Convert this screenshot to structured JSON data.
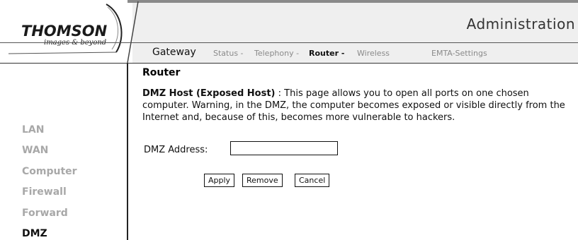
{
  "brand": {
    "name": "THOMSON",
    "tagline": "images & beyond"
  },
  "header": {
    "title": "Administration"
  },
  "nav": {
    "gateway": "Gateway",
    "items": [
      {
        "label": "Status -",
        "active": false
      },
      {
        "label": "Telephony -",
        "active": false
      },
      {
        "label": "Router -",
        "active": true
      },
      {
        "label": "Wireless",
        "active": false
      },
      {
        "label": "EMTA-Settings",
        "active": false
      }
    ]
  },
  "sidebar": {
    "items": [
      {
        "label": "LAN",
        "active": false
      },
      {
        "label": "WAN",
        "active": false
      },
      {
        "label": "Computer",
        "active": false
      },
      {
        "label": "Firewall",
        "active": false
      },
      {
        "label": "Forward",
        "active": false
      },
      {
        "label": "DMZ",
        "active": true
      }
    ]
  },
  "content": {
    "title": "Router",
    "desc_bold": "DMZ Host (Exposed Host)",
    "desc_text": " : This page allows you to open all ports on one chosen computer. Warning, in the DMZ, the computer becomes exposed or visible directly from the Internet and, because of this, becomes more vulnerable to hackers.",
    "dmz_label": "DMZ Address:",
    "dmz_value": "",
    "buttons": {
      "apply": "Apply",
      "remove": "Remove",
      "cancel": "Cancel"
    }
  },
  "colors": {
    "header_bg": "#efefef",
    "inactive_text": "#a8a8a8",
    "rule": "#222222"
  }
}
